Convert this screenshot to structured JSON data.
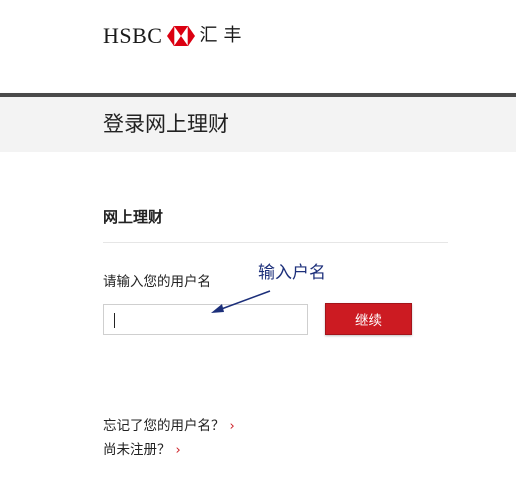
{
  "header": {
    "brand_name": "HSBC",
    "brand_cn": "汇丰",
    "logo_icon": "hsbc-hexagon-logo-icon",
    "brand_color": "#db0011"
  },
  "page": {
    "title": "登录网上理财"
  },
  "login": {
    "section_title": "网上理财",
    "username_label": "请输入您的用户名",
    "username_value": "",
    "continue_label": "继续"
  },
  "annotation": {
    "text": "输入户名",
    "color": "#1c2f7a"
  },
  "links": {
    "forgot_username": "忘记了您的用户名？",
    "not_registered": "尚未注册？",
    "chevron_icon": "chevron-right-icon"
  },
  "colors": {
    "accent": "#cc1b22",
    "title_band": "#f3f3f3"
  }
}
